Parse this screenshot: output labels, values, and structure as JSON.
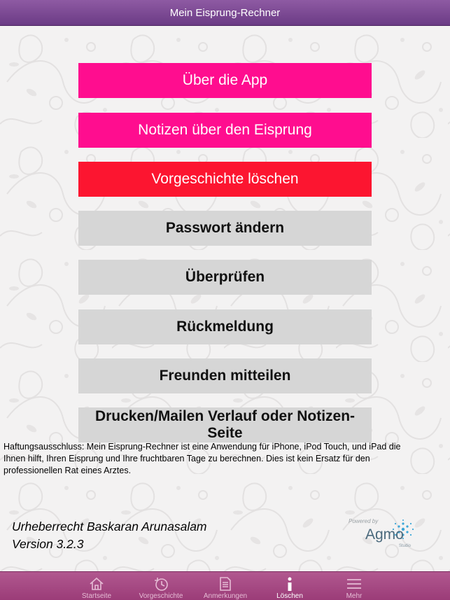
{
  "header": {
    "title": "Mein Eisprung-Rechner"
  },
  "menu": {
    "about": "Über die App",
    "notes": "Notizen über den Eisprung",
    "delete_history": "Vorgeschichte löschen",
    "change_password": "Passwort ändern",
    "review": "Überprüfen",
    "feedback": "Rückmeldung",
    "tell_friends": "Freunden mitteilen",
    "print_mail_line1": "Drucken/Mailen Verlauf oder Notizen-",
    "print_mail_line2": "Seite"
  },
  "disclaimer": {
    "line1": "Haftungsausschluss: Mein Eisprung-Rechner ist eine Anwendung für iPhone, iPod Touch, und iPad die",
    "line2": "Ihnen hilft, Ihren Eisprung und Ihre fruchtbaren Tage zu berechnen. Dies ist kein Ersatz  für den",
    "line3": "professionellen Rat eines Arztes."
  },
  "footer": {
    "copyright": "Urheberrecht Baskaran Arunasalam",
    "version": "Version 3.2.3",
    "powered_by": "Powered by",
    "brand": "Agmo",
    "brand_sub": "Studio"
  },
  "tabs": [
    {
      "label": "Startseite",
      "icon": "home-icon"
    },
    {
      "label": "Vorgeschichte",
      "icon": "history-icon"
    },
    {
      "label": "Anmerkungen",
      "icon": "notes-icon"
    },
    {
      "label": "Löschen",
      "icon": "info-icon",
      "active": true
    },
    {
      "label": "Mehr",
      "icon": "more-icon"
    }
  ],
  "colors": {
    "nav": "#7a4892",
    "pink_button": "#ff0d8f",
    "red_button": "#fc1530",
    "gray_button": "#d6d6d6",
    "tab_bar": "#a94985"
  }
}
